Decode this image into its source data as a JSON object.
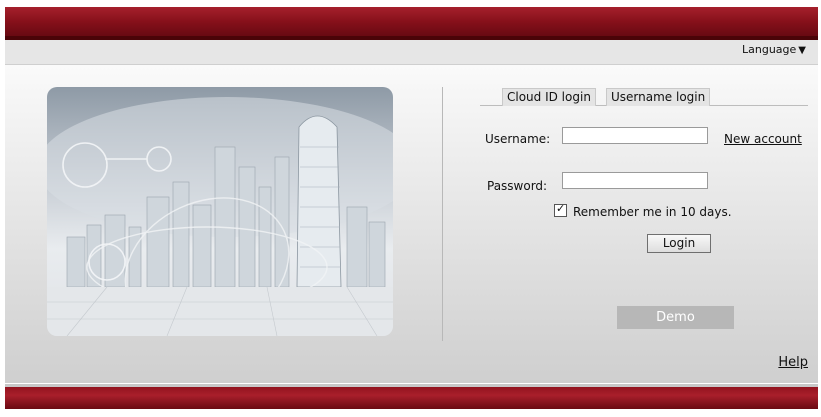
{
  "header": {
    "language_label": "Language",
    "language_arrow": "▼"
  },
  "login": {
    "tabs": [
      "Cloud ID login",
      "Username login"
    ],
    "username_label": "Username:",
    "username_value": "",
    "password_label": "Password:",
    "password_value": "",
    "new_account_link": "New account",
    "remember_label": "Remember me in 10 days.",
    "remember_checked": true,
    "login_button": "Login",
    "demo_button": "Demo"
  },
  "footer": {
    "help_link": "Help"
  },
  "colors": {
    "brand_red": "#86101a",
    "demo_gray": "#b7b7b7"
  }
}
